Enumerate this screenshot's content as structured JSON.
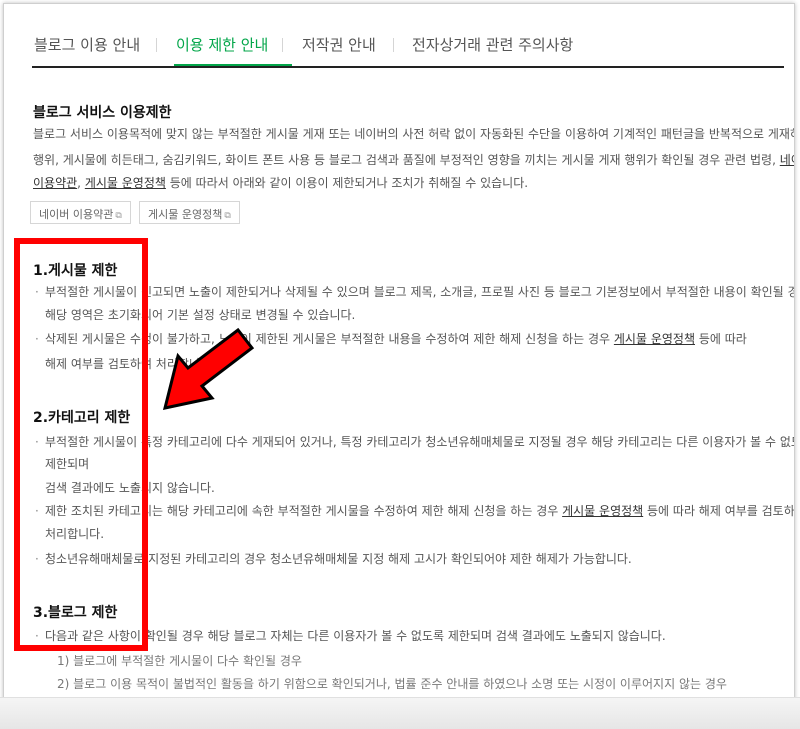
{
  "tabs": [
    {
      "label": "블로그 이용 안내"
    },
    {
      "label": "이용 제한 안내"
    },
    {
      "label": "저작권 안내"
    },
    {
      "label": "전자상거래 관련 주의사항"
    }
  ],
  "active_tab": "이용 제한 안내",
  "intro": {
    "title": "블로그 서비스 이용제한",
    "line1": "블로그 서비스 이용목적에 맞지 않는 부적절한 게시물 게재 또는 네이버의 사전 허락 없이 자동화된 수단을 이용하여 기계적인 패턴글을 반복적으로 게재하는",
    "line2": "행위, 게시물에 히든태그, 숨김키워드, 화이트 폰트 사용 등 블로그 검색과 품질에 부정적인 영향을 끼치는 게시물 게재 행위가 확인될 경우 관련 법령,",
    "line2_link": "네이버",
    "line3_link1": "이용약관",
    "line3_sep": ", ",
    "line3_link2": "게시물 운영정책",
    "line3_rest": " 등에 따라서 아래와 같이 이용이 제한되거나 조치가 취해질 수 있습니다.",
    "buttons": [
      "네이버 이용약관",
      "게시물 운영정책"
    ],
    "external_icon": "external-link-icon"
  },
  "sections": {
    "s1": {
      "title": "1.게시물 제한",
      "b1_l1": "부적절한 게시물이 신고되면 노출이 제한되거나 삭제될 수 있으며 블로그 제목, 소개글, 프로필 사진 등 블로그 기본정보에서 부적절한 내용이 확인될 경우",
      "b1_l2": "해당 영역은 초기화되어 기본 설정 상태로 변경될 수 있습니다.",
      "b2_l1": "삭제된 게시물은 수정이 불가하고, 노출이 제한된 게시물은 부적절한 내용을 수정하여 제한 해제 신청을 하는 경우 ",
      "b2_link": "게시물 운영정책",
      "b2_l1_end": " 등에 따라",
      "b2_l2": "해제 여부를 검토하여 처리합니다."
    },
    "s2": {
      "title": "2.카테고리 제한",
      "b1_l1": "부적절한 게시물이 특정 카테고리에 다수 게재되어 있거나, 특정 카테고리가 청소년유해매체물로 지정될 경우 해당 카테고리는 다른 이용자가 볼 수 없도록",
      "b1_l2": "제한되며",
      "b1_l3": "검색 결과에도 노출되지 않습니다.",
      "b2_l1": "제한 조치된 카테고리는 해당 카테고리에 속한 부적절한 게시물을 수정하여 제한 해제 신청을 하는 경우 ",
      "b2_link": "게시물 운영정책",
      "b2_l1_end": " 등에 따라 해제 여부를 검토하여",
      "b2_l2": "처리합니다.",
      "b3": "청소년유해매체물로 지정된 카테고리의 경우 청소년유해매체물 지정 해제 고시가 확인되어야 제한 해제가 가능합니다."
    },
    "s3": {
      "title": "3.블로그 제한",
      "b1": "다음과 같은 사항이 확인될 경우 해당 블로그 자체는 다른 이용자가 볼 수 없도록 제한되며 검색 결과에도 노출되지 않습니다.",
      "sub1": "1) 블로그에 부적절한 게시물이 다수 확인될 경우",
      "sub2": "2) 블로그 이용 목적이 불법적인 활동을 하기 위함으로 확인되거나, 법률 준수 안내를 하였으나 소명 또는 시정이 이루어지지 않는 경우"
    }
  },
  "bullet_char": "·",
  "colors": {
    "accent": "#03a64a",
    "annotation": "#ff0000"
  }
}
